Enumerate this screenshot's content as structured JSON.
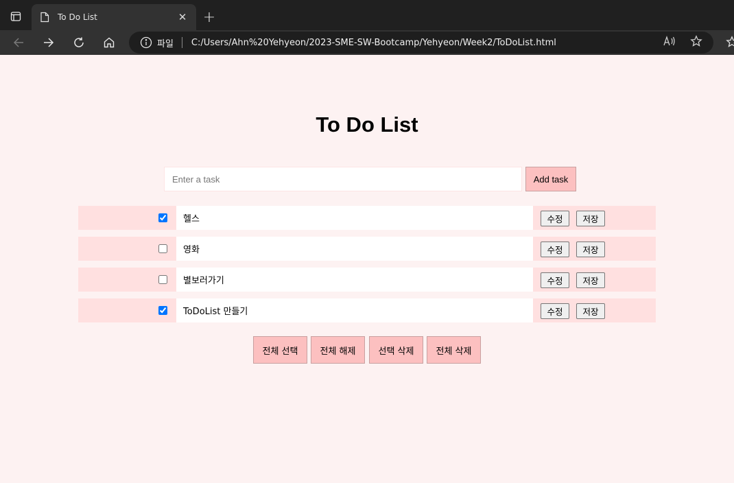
{
  "browser": {
    "tab_title": "To Do List",
    "tab_close": "✕",
    "new_tab": "+",
    "protocol_label": "파일",
    "url": "C:/Users/Ahn%20Yehyeon/2023-SME-SW-Bootcamp/Yehyeon/Week2/ToDoList.html"
  },
  "page": {
    "title": "To Do List",
    "input": {
      "placeholder": "Enter a task",
      "value": ""
    },
    "add_button": "Add task",
    "todos": [
      {
        "text": "헬스",
        "checked": true,
        "edit_label": "수정",
        "save_label": "저장"
      },
      {
        "text": "영화",
        "checked": false,
        "edit_label": "수정",
        "save_label": "저장"
      },
      {
        "text": "별보러가기",
        "checked": false,
        "edit_label": "수정",
        "save_label": "저장"
      },
      {
        "text": "ToDoList 만들기",
        "checked": true,
        "edit_label": "수정",
        "save_label": "저장"
      }
    ],
    "bulk_actions": {
      "select_all": "전체 선택",
      "deselect_all": "전체 해제",
      "delete_selected": "선택 삭제",
      "delete_all": "전체 삭제"
    }
  },
  "colors": {
    "page_bg": "#fdf2f2",
    "row_bg": "#ffe0e0",
    "button_bg": "#fcc0c0"
  }
}
